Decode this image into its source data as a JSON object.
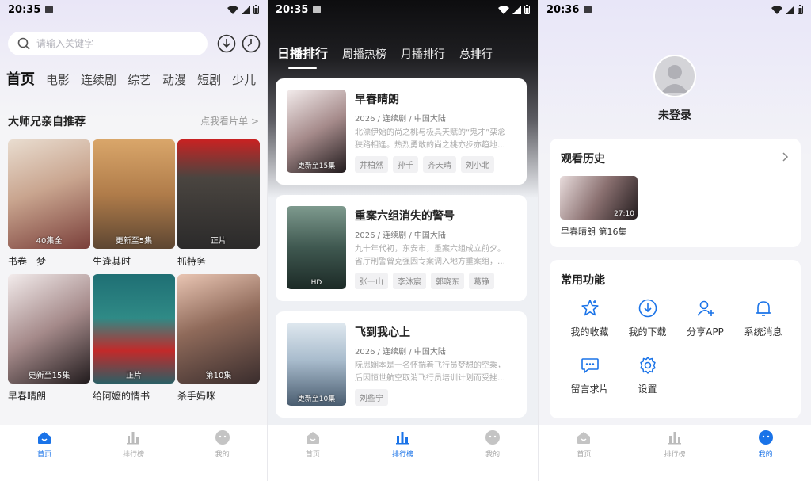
{
  "status": {
    "home_time": "20:35",
    "rank_time": "20:35",
    "me_time": "20:36"
  },
  "home": {
    "search_placeholder": "请输入关键字",
    "categories": [
      "首页",
      "电影",
      "连续剧",
      "综艺",
      "动漫",
      "短剧",
      "少儿"
    ],
    "section_title": "大师兄亲自推荐",
    "section_more": "点我看片单 >",
    "items": [
      {
        "title": "书卷一梦",
        "badge": "40集全"
      },
      {
        "title": "生逢其时",
        "badge": "更新至5集"
      },
      {
        "title": "抓特务",
        "badge": "正片"
      },
      {
        "title": "早春晴朗",
        "badge": "更新至15集"
      },
      {
        "title": "给阿嬷的情书",
        "badge": "正片"
      },
      {
        "title": "杀手妈咪",
        "badge": "第10集"
      }
    ]
  },
  "rank": {
    "tabs": [
      "日播排行",
      "周播热榜",
      "月播排行",
      "总排行"
    ],
    "items": [
      {
        "title": "早春晴朗",
        "meta": "2026 / 连续剧 / 中国大陆",
        "desc_lines": [
          "北漂伊始的尚之桃与极具天赋的“鬼才”栾念",
          "狭路相逢。热烈勇敢的尚之桃亦步亦趋地…"
        ],
        "badge": "更新至15集",
        "tags": [
          "井柏然",
          "孙千",
          "齐天晴",
          "刘小北"
        ]
      },
      {
        "title": "重案六组消失的警号",
        "meta": "2026 / 连续剧 / 中国大陆",
        "desc_lines": [
          "九十年代初，东安市，重案六组成立前夕。",
          "省厅刑警曾克强因专案调入地方重案组，…"
        ],
        "badge": "HD",
        "tags": [
          "张一山",
          "李沐宸",
          "郭晓东",
          "葛铮"
        ]
      },
      {
        "title": "飞到我心上",
        "meta": "2026 / 连续剧 / 中国大陆",
        "desc_lines": [
          "阮思娴本是一名怀揣着飞行员梦想的空乘，",
          "后因恒世航空取消飞行员培训计划而受挫…"
        ],
        "badge": "更新至10集",
        "tags": [
          "刘些宁"
        ]
      }
    ]
  },
  "me": {
    "login_text": "未登录",
    "history_title": "观看历史",
    "history_item": {
      "label": "早春晴朗 第16集",
      "duration": "27:10"
    },
    "functions_title": "常用功能",
    "functions": [
      {
        "label": "我的收藏",
        "icon": "star-icon"
      },
      {
        "label": "我的下载",
        "icon": "download-icon"
      },
      {
        "label": "分享APP",
        "icon": "add-user-icon"
      },
      {
        "label": "系统消息",
        "icon": "bell-icon"
      },
      {
        "label": "留言求片",
        "icon": "message-icon"
      },
      {
        "label": "设置",
        "icon": "gear-icon"
      }
    ]
  },
  "tabbar": [
    "首页",
    "排行榜",
    "我的"
  ],
  "colors": {
    "accent": "#1a73e8",
    "inactive": "#aaaaaa"
  }
}
